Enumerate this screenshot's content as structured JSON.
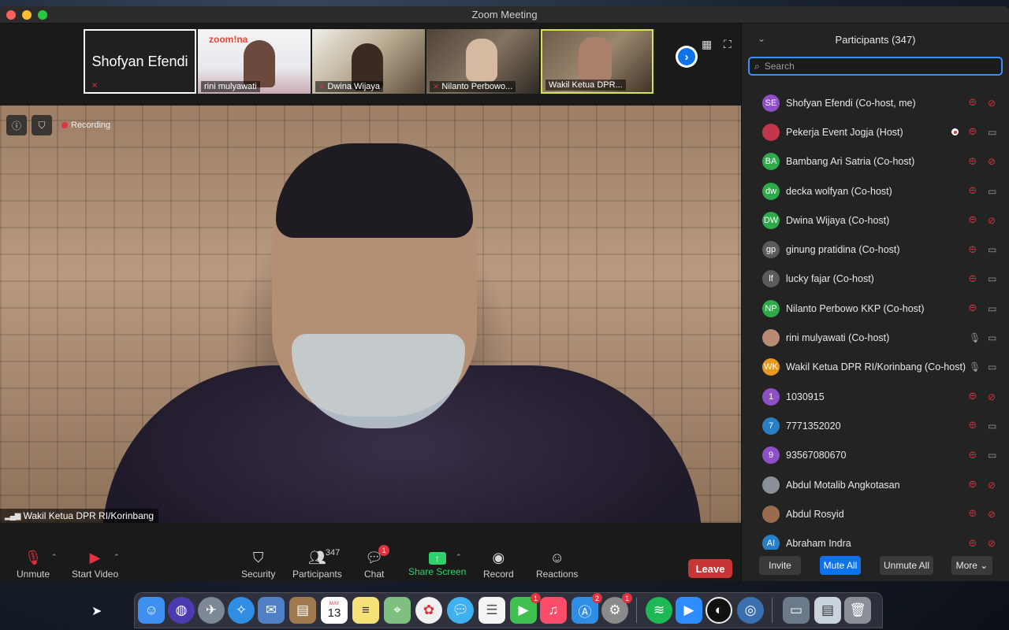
{
  "window": {
    "title": "Zoom Meeting"
  },
  "thumbnails": [
    {
      "name": "Shofyan Efendi",
      "big_name": "Shofyan Efendi",
      "muted": true
    },
    {
      "name": "rini mulyawati",
      "logo": "zoom!na",
      "muted": false
    },
    {
      "name": "Dwina Wijaya",
      "muted": true
    },
    {
      "name": "Nilanto Perbowo...",
      "muted": true
    },
    {
      "name": "Wakil Ketua DPR...",
      "muted": false,
      "active": true
    }
  ],
  "video": {
    "recording_label": "Recording",
    "speaker_name": "Wakil Ketua DPR RI/Korinbang"
  },
  "toolbar": {
    "unmute": "Unmute",
    "start_video": "Start Video",
    "security": "Security",
    "participants": "Participants",
    "participants_count": "347",
    "chat": "Chat",
    "chat_badge": "1",
    "share_screen": "Share Screen",
    "record": "Record",
    "reactions": "Reactions",
    "leave": "Leave"
  },
  "panel": {
    "title": "Participants (347)",
    "search_placeholder": "Search",
    "participants": [
      {
        "initials": "SE",
        "color": "#8e4fc7",
        "name": "Shofyan Efendi (Co-host, me)",
        "mic": "muted",
        "cam": "off"
      },
      {
        "initials": "",
        "color": "#c2384a",
        "name": "Pekerja Event Jogja (Host)",
        "mic": "muted",
        "cam": "on",
        "recording": true
      },
      {
        "initials": "BA",
        "color": "#2faa4a",
        "name": "Bambang Ari Satria (Co-host)",
        "mic": "muted",
        "cam": "off"
      },
      {
        "initials": "dw",
        "color": "#2faa4a",
        "name": "decka wolfyan (Co-host)",
        "mic": "muted",
        "cam": "on"
      },
      {
        "initials": "DW",
        "color": "#2faa4a",
        "name": "Dwina Wijaya (Co-host)",
        "mic": "muted",
        "cam": "off"
      },
      {
        "initials": "gp",
        "color": "#5b5b5b",
        "name": "ginung pratidina (Co-host)",
        "mic": "muted",
        "cam": "on"
      },
      {
        "initials": "lf",
        "color": "#5b5b5b",
        "name": "lucky fajar (Co-host)",
        "mic": "muted",
        "cam": "on"
      },
      {
        "initials": "NP",
        "color": "#2faa4a",
        "name": "Nilanto Perbowo KKP (Co-host)",
        "mic": "muted",
        "cam": "on"
      },
      {
        "initials": "",
        "color": "#b98a74",
        "name": "rini mulyawati (Co-host)",
        "mic": "on",
        "cam": "on"
      },
      {
        "initials": "WK",
        "color": "#e89a1e",
        "name": "Wakil Ketua DPR RI/Korinbang (Co-host)",
        "mic": "on",
        "cam": "on"
      },
      {
        "initials": "1",
        "color": "#8e4fc7",
        "name": "1030915",
        "mic": "muted",
        "cam": "off"
      },
      {
        "initials": "7",
        "color": "#2a7fc4",
        "name": "7771352020",
        "mic": "muted",
        "cam": "on"
      },
      {
        "initials": "9",
        "color": "#8e4fc7",
        "name": "93567080670",
        "mic": "muted",
        "cam": "on"
      },
      {
        "initials": "",
        "color": "#8a8f98",
        "name": "Abdul Motalib Angkotasan",
        "mic": "muted",
        "cam": "off"
      },
      {
        "initials": "",
        "color": "#9a6b4f",
        "name": "Abdul Rosyid",
        "mic": "muted",
        "cam": "off"
      },
      {
        "initials": "AI",
        "color": "#2a7fc4",
        "name": "Abraham Indra",
        "mic": "muted",
        "cam": "off"
      }
    ],
    "footer": {
      "invite": "Invite",
      "mute_all": "Mute All",
      "unmute_all": "Unmute All",
      "more": "More ⌄"
    }
  },
  "dock": {
    "calendar_month": "MAY",
    "calendar_day": "13",
    "badges": {
      "facetime": "1",
      "appstore": "2",
      "settings": "1"
    }
  }
}
